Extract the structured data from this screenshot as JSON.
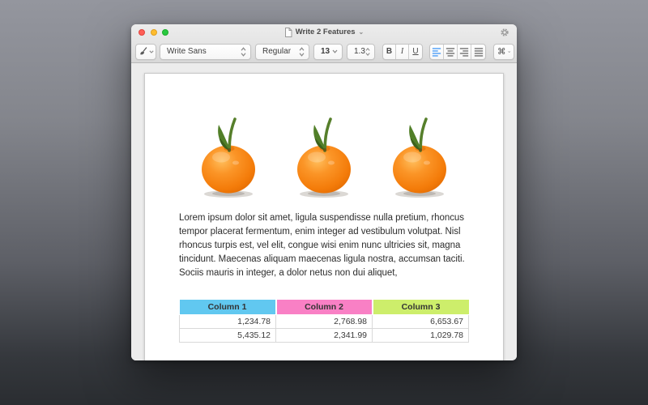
{
  "window": {
    "title": "Write 2 Features"
  },
  "toolbar": {
    "font_family": "Write Sans",
    "font_style": "Regular",
    "font_size": "13",
    "line_spacing": "1.3",
    "bold_label": "B",
    "italic_label": "I",
    "underline_label": "U",
    "active_alignment": "left",
    "shortcuts_label": "⌘"
  },
  "colors": {
    "accent_blue": "#4a9df8",
    "traffic_red": "#ff5f57",
    "traffic_yellow": "#febc2e",
    "traffic_green": "#28c840"
  },
  "document": {
    "images": [
      {
        "name": "tangerine"
      },
      {
        "name": "tangerine"
      },
      {
        "name": "tangerine"
      }
    ],
    "paragraph": "Lorem ipsum dolor sit amet, ligula suspendisse nulla pretium, rhoncus tempor placerat fermentum, enim integer ad vestibulum volutpat. Nisl rhoncus turpis est, vel elit, congue wisi enim nunc ultricies sit, magna tincidunt. Maecenas aliquam maecenas ligula nostra, accumsan taciti. Sociis mauris in integer, a dolor netus non dui aliquet,",
    "table": {
      "headers": [
        {
          "label": "Column 1",
          "color": "#61c8f0"
        },
        {
          "label": "Column 2",
          "color": "#f980c5"
        },
        {
          "label": "Column 3",
          "color": "#cdee6b"
        }
      ],
      "rows": [
        [
          "1,234.78",
          "2,768.98",
          "6,653.67"
        ],
        [
          "5,435.12",
          "2,341.99",
          "1,029.78"
        ]
      ]
    }
  }
}
